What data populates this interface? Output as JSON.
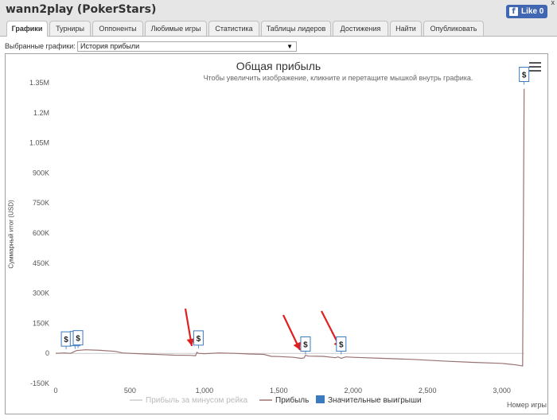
{
  "window": {
    "title": "wann2play (PokerStars)",
    "close_label": "x"
  },
  "facebook": {
    "label": "Like 0",
    "f": "f"
  },
  "tabs": [
    {
      "label": "Графики",
      "active": true
    },
    {
      "label": "Турниры"
    },
    {
      "label": "Оппоненты"
    },
    {
      "label": "Любимые игры"
    },
    {
      "label": "Статистика"
    },
    {
      "label": "Таблицы лидеров"
    },
    {
      "label": "Достижения"
    },
    {
      "label": "Найти"
    },
    {
      "label": "Опубликовать"
    }
  ],
  "selector": {
    "label": "Выбранные графики:",
    "value": "История прибыли"
  },
  "chart_data": {
    "type": "line",
    "title": "Общая прибыль",
    "subtitle": "Чтобы увеличить изображение, кликните и перетащите мышкой внутрь графика.",
    "ylabel": "Суммарный итог (USD)",
    "xlabel": "Номер игры",
    "xlim": [
      0,
      3200
    ],
    "ylim": [
      -150000,
      1350000
    ],
    "x_ticks": [
      0,
      500,
      1000,
      1500,
      2000,
      2500,
      3000
    ],
    "x_tick_labels": [
      "0",
      "500",
      "1,000",
      "1,500",
      "2,000",
      "2,500",
      "3,000"
    ],
    "y_ticks": [
      -150000,
      0,
      150000,
      300000,
      450000,
      600000,
      750000,
      900000,
      1050000,
      1200000,
      1350000
    ],
    "y_tick_labels": [
      "-150K",
      "0",
      "150K",
      "300K",
      "450K",
      "600K",
      "750K",
      "900K",
      "1.05M",
      "1.2M",
      "1.35M"
    ],
    "grid": false,
    "legend_position": "bottom",
    "series": [
      {
        "name": "Прибыль за минусом рейка",
        "color": "#cccccc",
        "x": [
          0,
          3150
        ],
        "y": [
          0,
          0
        ]
      },
      {
        "name": "Прибыль",
        "color": "#9a7272",
        "x": [
          0,
          60,
          100,
          140,
          170,
          200,
          300,
          400,
          450,
          500,
          600,
          700,
          800,
          900,
          940,
          950,
          960,
          1000,
          1100,
          1200,
          1300,
          1400,
          1450,
          1500,
          1600,
          1650,
          1670,
          1680,
          1700,
          1800,
          1880,
          1900,
          1920,
          1950,
          2000,
          2200,
          2400,
          2600,
          2800,
          3000,
          3100,
          3140,
          3150
        ],
        "y": [
          0,
          2000,
          0,
          14000,
          16000,
          18000,
          15000,
          10000,
          2000,
          0,
          -3000,
          -6000,
          -9000,
          -10000,
          -12000,
          5000,
          0,
          -2000,
          2000,
          0,
          -3000,
          -5000,
          -15000,
          -16000,
          -20000,
          -25000,
          -23000,
          -10000,
          -14000,
          -15000,
          -22000,
          -18000,
          -25000,
          -18000,
          -20000,
          -25000,
          -30000,
          -38000,
          -45000,
          -50000,
          -58000,
          -63000,
          1320000
        ]
      },
      {
        "name": "Значительные выигрыши",
        "color": "#3a7abf",
        "x": [
          70,
          130,
          150,
          960,
          1680,
          1920,
          3150
        ],
        "y": [
          20000,
          22000,
          26000,
          25000,
          -5000,
          -5000,
          1340000
        ]
      }
    ],
    "flag_label": "$"
  }
}
